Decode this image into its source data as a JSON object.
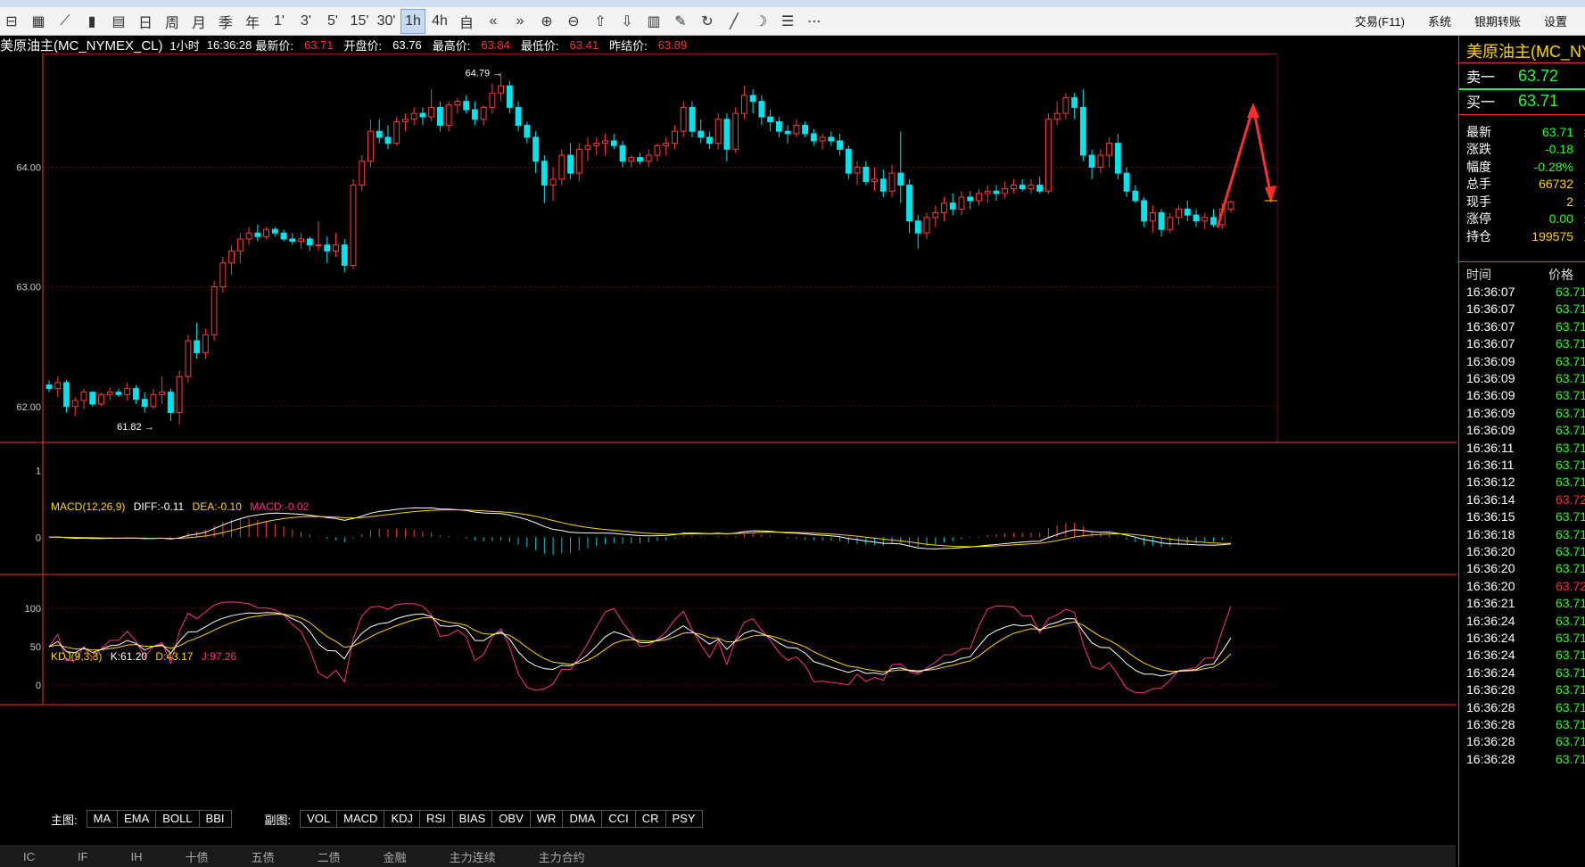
{
  "toolbar": {
    "icons": [
      "chart-icon",
      "list-icon",
      "line-chart-icon",
      "candle-icon",
      "fenshi-icon"
    ],
    "periods": [
      "日",
      "周",
      "月",
      "季",
      "年",
      "1'",
      "3'",
      "5'",
      "15'",
      "30'",
      "1h",
      "4h",
      "自"
    ],
    "active_period": "1h",
    "right_items": [
      "交易(F11)",
      "系统",
      "银期转账",
      "设置"
    ]
  },
  "info": {
    "symbol": "美原油主(MC_NYMEX_CL)",
    "period": "1小时",
    "time": "16:36:28",
    "latest_label": "最新价:",
    "latest": "63.71",
    "open_label": "开盘价:",
    "open": "63.76",
    "high_label": "最高价:",
    "high": "63.84",
    "low_label": "最低价:",
    "low": "63.41",
    "prevsettle_label": "昨结价:",
    "prevsettle": "63.89"
  },
  "chart_data": {
    "type": "candlestick",
    "y_ticks": [
      "64.00",
      "63.00",
      "62.00"
    ],
    "y_tick_values": [
      64.0,
      63.0,
      62.0
    ],
    "ylim": [
      61.7,
      64.95
    ],
    "max_marker": "64.79",
    "min_marker": "61.82",
    "candles": [
      [
        62.18,
        62.22,
        62.12,
        62.15
      ],
      [
        62.15,
        62.25,
        62.08,
        62.2
      ],
      [
        62.2,
        62.22,
        61.95,
        62.0
      ],
      [
        62.0,
        62.08,
        61.92,
        62.05
      ],
      [
        62.05,
        62.15,
        61.98,
        62.12
      ],
      [
        62.12,
        62.12,
        62.0,
        62.02
      ],
      [
        62.02,
        62.12,
        62.0,
        62.1
      ],
      [
        62.1,
        62.16,
        62.05,
        62.12
      ],
      [
        62.12,
        62.15,
        62.08,
        62.1
      ],
      [
        62.1,
        62.2,
        62.05,
        62.15
      ],
      [
        62.15,
        62.18,
        62.02,
        62.06
      ],
      [
        62.06,
        62.12,
        61.95,
        62.0
      ],
      [
        62.0,
        62.15,
        61.98,
        62.1
      ],
      [
        62.1,
        62.25,
        62.02,
        62.12
      ],
      [
        62.12,
        62.15,
        61.88,
        61.95
      ],
      [
        61.95,
        62.3,
        61.85,
        62.25
      ],
      [
        62.25,
        62.6,
        62.2,
        62.55
      ],
      [
        62.55,
        62.7,
        62.4,
        62.45
      ],
      [
        62.45,
        62.65,
        62.4,
        62.6
      ],
      [
        62.6,
        63.05,
        62.55,
        63.0
      ],
      [
        63.0,
        63.25,
        62.95,
        63.2
      ],
      [
        63.2,
        63.35,
        63.1,
        63.3
      ],
      [
        63.3,
        63.45,
        63.2,
        63.4
      ],
      [
        63.4,
        63.5,
        63.35,
        63.45
      ],
      [
        63.45,
        63.52,
        63.38,
        63.42
      ],
      [
        63.42,
        63.5,
        63.4,
        63.48
      ],
      [
        63.48,
        63.5,
        63.42,
        63.45
      ],
      [
        63.45,
        63.48,
        63.38,
        63.4
      ],
      [
        63.4,
        63.45,
        63.35,
        63.38
      ],
      [
        63.38,
        63.45,
        63.32,
        63.4
      ],
      [
        63.4,
        63.42,
        63.3,
        63.35
      ],
      [
        63.35,
        63.55,
        63.3,
        63.35
      ],
      [
        63.35,
        63.42,
        63.2,
        63.3
      ],
      [
        63.3,
        63.45,
        63.25,
        63.35
      ],
      [
        63.35,
        63.4,
        63.12,
        63.18
      ],
      [
        63.18,
        63.9,
        63.15,
        63.85
      ],
      [
        63.85,
        64.1,
        63.8,
        64.05
      ],
      [
        64.05,
        64.4,
        64.0,
        64.3
      ],
      [
        64.3,
        64.4,
        64.2,
        64.25
      ],
      [
        64.25,
        64.35,
        64.15,
        64.2
      ],
      [
        64.2,
        64.42,
        64.18,
        64.38
      ],
      [
        64.38,
        64.45,
        64.3,
        64.4
      ],
      [
        64.4,
        64.5,
        64.35,
        64.45
      ],
      [
        64.45,
        64.5,
        64.35,
        64.42
      ],
      [
        64.42,
        64.65,
        64.38,
        64.5
      ],
      [
        64.5,
        64.55,
        64.3,
        64.35
      ],
      [
        64.35,
        64.55,
        64.3,
        64.52
      ],
      [
        64.52,
        64.58,
        64.45,
        64.55
      ],
      [
        64.55,
        64.6,
        64.45,
        64.48
      ],
      [
        64.48,
        64.55,
        64.35,
        64.4
      ],
      [
        64.4,
        64.52,
        64.35,
        64.5
      ],
      [
        64.5,
        64.7,
        64.45,
        64.62
      ],
      [
        64.62,
        64.79,
        64.55,
        64.68
      ],
      [
        64.68,
        64.72,
        64.45,
        64.5
      ],
      [
        64.5,
        64.55,
        64.3,
        64.35
      ],
      [
        64.35,
        64.38,
        64.2,
        64.25
      ],
      [
        64.25,
        64.3,
        63.95,
        64.05
      ],
      [
        64.05,
        64.1,
        63.7,
        63.85
      ],
      [
        63.85,
        64.0,
        63.72,
        63.9
      ],
      [
        63.9,
        64.15,
        63.85,
        64.1
      ],
      [
        64.1,
        64.2,
        63.9,
        63.95
      ],
      [
        63.95,
        64.2,
        63.88,
        64.15
      ],
      [
        64.15,
        64.25,
        64.05,
        64.18
      ],
      [
        64.18,
        64.25,
        64.1,
        64.2
      ],
      [
        64.2,
        64.28,
        64.1,
        64.22
      ],
      [
        64.22,
        64.28,
        64.15,
        64.18
      ],
      [
        64.18,
        64.22,
        64.0,
        64.05
      ],
      [
        64.05,
        64.1,
        64.0,
        64.08
      ],
      [
        64.08,
        64.12,
        64.02,
        64.05
      ],
      [
        64.05,
        64.15,
        64.0,
        64.1
      ],
      [
        64.1,
        64.2,
        64.05,
        64.18
      ],
      [
        64.18,
        64.25,
        64.1,
        64.2
      ],
      [
        64.2,
        64.35,
        64.15,
        64.3
      ],
      [
        64.3,
        64.55,
        64.25,
        64.5
      ],
      [
        64.5,
        64.55,
        64.25,
        64.3
      ],
      [
        64.3,
        64.4,
        64.2,
        64.25
      ],
      [
        64.25,
        64.3,
        64.15,
        64.2
      ],
      [
        64.2,
        64.45,
        64.15,
        64.4
      ],
      [
        64.4,
        64.45,
        64.05,
        64.15
      ],
      [
        64.15,
        64.5,
        64.12,
        64.45
      ],
      [
        64.45,
        64.68,
        64.4,
        64.6
      ],
      [
        64.6,
        64.65,
        64.45,
        64.55
      ],
      [
        64.55,
        64.6,
        64.35,
        64.42
      ],
      [
        64.42,
        64.48,
        64.3,
        64.38
      ],
      [
        64.38,
        64.42,
        64.25,
        64.3
      ],
      [
        64.3,
        64.35,
        64.2,
        64.28
      ],
      [
        64.28,
        64.4,
        64.25,
        64.35
      ],
      [
        64.35,
        64.38,
        64.25,
        64.28
      ],
      [
        64.28,
        64.32,
        64.18,
        64.22
      ],
      [
        64.22,
        64.28,
        64.15,
        64.25
      ],
      [
        64.25,
        64.3,
        64.18,
        64.22
      ],
      [
        64.22,
        64.28,
        64.1,
        64.15
      ],
      [
        64.15,
        64.18,
        63.9,
        63.95
      ],
      [
        63.95,
        64.05,
        63.85,
        64.0
      ],
      [
        64.0,
        64.05,
        63.85,
        63.88
      ],
      [
        63.88,
        64.0,
        63.8,
        63.9
      ],
      [
        63.9,
        63.98,
        63.75,
        63.8
      ],
      [
        63.8,
        64.02,
        63.75,
        63.95
      ],
      [
        63.95,
        64.3,
        63.7,
        63.85
      ],
      [
        63.85,
        63.9,
        63.45,
        63.55
      ],
      [
        63.55,
        63.6,
        63.32,
        63.45
      ],
      [
        63.45,
        63.62,
        63.4,
        63.58
      ],
      [
        63.58,
        63.68,
        63.5,
        63.62
      ],
      [
        63.62,
        63.75,
        63.55,
        63.7
      ],
      [
        63.7,
        63.78,
        63.6,
        63.65
      ],
      [
        63.65,
        63.8,
        63.6,
        63.75
      ],
      [
        63.75,
        63.8,
        63.65,
        63.72
      ],
      [
        63.72,
        63.82,
        63.68,
        63.78
      ],
      [
        63.78,
        63.85,
        63.7,
        63.8
      ],
      [
        63.8,
        63.85,
        63.72,
        63.78
      ],
      [
        63.78,
        63.88,
        63.74,
        63.82
      ],
      [
        63.82,
        63.9,
        63.78,
        63.85
      ],
      [
        63.85,
        63.9,
        63.8,
        63.82
      ],
      [
        63.82,
        63.9,
        63.78,
        63.85
      ],
      [
        63.85,
        63.92,
        63.78,
        63.8
      ],
      [
        63.8,
        64.45,
        63.78,
        64.4
      ],
      [
        64.4,
        64.55,
        64.35,
        64.45
      ],
      [
        64.45,
        64.62,
        64.4,
        64.58
      ],
      [
        64.58,
        64.62,
        64.4,
        64.5
      ],
      [
        64.5,
        64.65,
        64.05,
        64.1
      ],
      [
        64.1,
        64.15,
        63.9,
        64.0
      ],
      [
        64.0,
        64.15,
        63.95,
        64.1
      ],
      [
        64.1,
        64.25,
        64.0,
        64.2
      ],
      [
        64.2,
        64.28,
        63.9,
        63.95
      ],
      [
        63.95,
        64.0,
        63.75,
        63.8
      ],
      [
        63.8,
        63.85,
        63.7,
        63.72
      ],
      [
        63.72,
        63.75,
        63.5,
        63.55
      ],
      [
        63.55,
        63.68,
        63.45,
        63.62
      ],
      [
        63.62,
        63.65,
        63.42,
        63.48
      ],
      [
        63.48,
        63.62,
        63.45,
        63.58
      ],
      [
        63.58,
        63.68,
        63.52,
        63.65
      ],
      [
        63.65,
        63.72,
        63.55,
        63.6
      ],
      [
        63.6,
        63.65,
        63.5,
        63.55
      ],
      [
        63.55,
        63.62,
        63.48,
        63.58
      ],
      [
        63.58,
        63.65,
        63.5,
        63.52
      ],
      [
        63.52,
        63.7,
        63.48,
        63.65
      ],
      [
        63.65,
        63.72,
        63.62,
        63.71
      ]
    ]
  },
  "macd": {
    "label": "MACD(12,26,9)",
    "diff_label": "DIFF:",
    "diff": "-0.11",
    "dea_label": "DEA:",
    "dea": "-0.10",
    "macd_label": "MACD:",
    "macd_value": "-0.02",
    "y_ticks": [
      "1",
      "0"
    ],
    "ylim": [
      -0.45,
      1.15
    ]
  },
  "kdj": {
    "label": "KDJ(9,3,3)",
    "k_label": "K:",
    "k": "61.20",
    "d_label": "D:",
    "d": "43.17",
    "j_label": "J:",
    "j": "97.26",
    "y_ticks": [
      "100",
      "50",
      "0"
    ]
  },
  "indicator_tabs": {
    "main_label": "主图:",
    "main": [
      "MA",
      "EMA",
      "BOLL",
      "BBI"
    ],
    "sub_label": "副图:",
    "sub": [
      "VOL",
      "MACD",
      "KDJ",
      "RSI",
      "BIAS",
      "OBV",
      "WR",
      "DMA",
      "CCI",
      "CR",
      "PSY"
    ]
  },
  "bottom_tabs": [
    "IC",
    "IF",
    "IH",
    "十债",
    "五债",
    "二债",
    "金融",
    "主力连续",
    "主力合约"
  ],
  "quote": {
    "title": "美原油主(MC_NY",
    "sell1_label": "卖一",
    "sell1": "63.72",
    "buy1_label": "买一",
    "buy1": "63.71",
    "stats": [
      {
        "k": "最新",
        "v": "63.71",
        "c": "g",
        "k2": "结"
      },
      {
        "k": "涨跌",
        "v": "-0.18",
        "c": "g",
        "k2": "昨"
      },
      {
        "k": "幅度",
        "v": "-0.28%",
        "c": "g",
        "k2": "昨"
      },
      {
        "k": "总手",
        "v": "66732",
        "c": "y",
        "k2": "开"
      },
      {
        "k": "现手",
        "v": "2",
        "c": "y",
        "k2": "最"
      },
      {
        "k": "涨停",
        "v": "0.00",
        "c": "g",
        "k2": "最"
      },
      {
        "k": "持仓",
        "v": "199575",
        "c": "y",
        "k2": "跌"
      }
    ],
    "ticks_header_time": "时间",
    "ticks_header_price": "价格",
    "ticks": [
      [
        "16:36:07",
        "63.71"
      ],
      [
        "16:36:07",
        "63.71"
      ],
      [
        "16:36:07",
        "63.71"
      ],
      [
        "16:36:07",
        "63.71"
      ],
      [
        "16:36:09",
        "63.71"
      ],
      [
        "16:36:09",
        "63.71"
      ],
      [
        "16:36:09",
        "63.71"
      ],
      [
        "16:36:09",
        "63.71"
      ],
      [
        "16:36:09",
        "63.71"
      ],
      [
        "16:36:11",
        "63.71"
      ],
      [
        "16:36:11",
        "63.71"
      ],
      [
        "16:36:12",
        "63.71"
      ],
      [
        "16:36:14",
        "63.72"
      ],
      [
        "16:36:15",
        "63.71"
      ],
      [
        "16:36:18",
        "63.71"
      ],
      [
        "16:36:20",
        "63.71"
      ],
      [
        "16:36:20",
        "63.71"
      ],
      [
        "16:36:20",
        "63.72"
      ],
      [
        "16:36:21",
        "63.71"
      ],
      [
        "16:36:24",
        "63.71"
      ],
      [
        "16:36:24",
        "63.71"
      ],
      [
        "16:36:24",
        "63.71"
      ],
      [
        "16:36:24",
        "63.71"
      ],
      [
        "16:36:28",
        "63.71"
      ],
      [
        "16:36:28",
        "63.71"
      ],
      [
        "16:36:28",
        "63.71"
      ],
      [
        "16:36:28",
        "63.71"
      ],
      [
        "16:36:28",
        "63.71"
      ]
    ]
  }
}
